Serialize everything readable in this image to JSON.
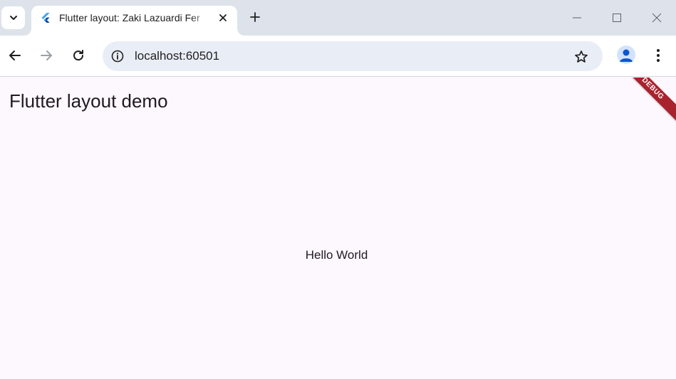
{
  "browser": {
    "tab": {
      "title": "Flutter layout: Zaki Lazuardi Fer",
      "favicon": "flutter-logo-icon"
    },
    "new_tab_icon": "plus-icon",
    "window_controls": [
      "minimize-icon",
      "maximize-icon",
      "close-icon"
    ],
    "address": {
      "url": "localhost:60501"
    }
  },
  "app": {
    "title": "Flutter layout demo",
    "body_text": "Hello World",
    "debug_banner": "DEBUG"
  },
  "colors": {
    "tabstrip": "#dee3eb",
    "omnibox": "#e9eef6",
    "page_background": "#fdf7fe",
    "debug_banner": "#a9232e",
    "avatar_accent": "#0b57d0"
  }
}
